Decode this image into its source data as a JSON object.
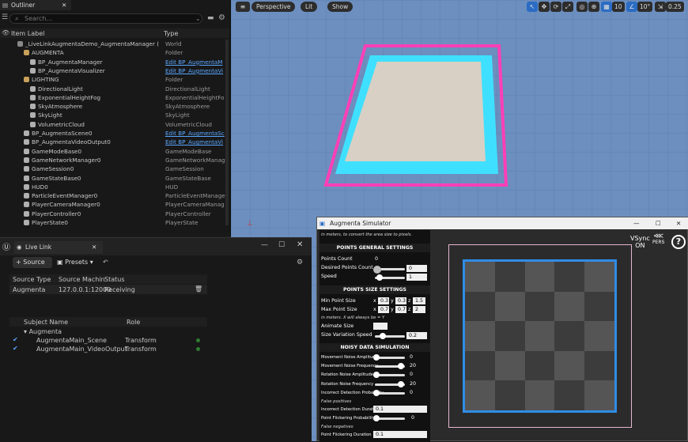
{
  "outliner": {
    "tab_label": "Outliner",
    "search_placeholder": "Search...",
    "col_label": "Item Label",
    "col_type": "Type",
    "rows": [
      {
        "name": "_LiveLinkAugmentaDemo_AugmentaManager (",
        "type": "World",
        "indent": 0,
        "link": false
      },
      {
        "name": "AUGMENTA",
        "type": "Folder",
        "indent": 1,
        "link": false
      },
      {
        "name": "BP_AugmentaManager",
        "type": "Edit BP_AugmentaM",
        "indent": 2,
        "link": true
      },
      {
        "name": "BP_AugmentaVisualizer",
        "type": "Edit BP_AugmentaVi",
        "indent": 2,
        "link": true
      },
      {
        "name": "LIGHTING",
        "type": "Folder",
        "indent": 1,
        "link": false
      },
      {
        "name": "DirectionalLight",
        "type": "DirectionalLight",
        "indent": 2,
        "link": false
      },
      {
        "name": "ExponentialHeightFog",
        "type": "ExponentialHeightFo",
        "indent": 2,
        "link": false
      },
      {
        "name": "SkyAtmosphere",
        "type": "SkyAtmosphere",
        "indent": 2,
        "link": false
      },
      {
        "name": "SkyLight",
        "type": "SkyLight",
        "indent": 2,
        "link": false
      },
      {
        "name": "VolumetricCloud",
        "type": "VolumetricCloud",
        "indent": 2,
        "link": false
      },
      {
        "name": "BP_AugmentaScene0",
        "type": "Edit BP_AugmentaSc",
        "indent": 1,
        "link": true
      },
      {
        "name": "BP_AugmentaVideoOutput0",
        "type": "Edit BP_AugmentaVi",
        "indent": 1,
        "link": true
      },
      {
        "name": "GameModeBase0",
        "type": "GameModeBase",
        "indent": 1,
        "link": false
      },
      {
        "name": "GameNetworkManager0",
        "type": "GameNetworkManag",
        "indent": 1,
        "link": false
      },
      {
        "name": "GameSession0",
        "type": "GameSession",
        "indent": 1,
        "link": false
      },
      {
        "name": "GameStateBase0",
        "type": "GameStateBase",
        "indent": 1,
        "link": false
      },
      {
        "name": "HUD0",
        "type": "HUD",
        "indent": 1,
        "link": false
      },
      {
        "name": "ParticleEventManager0",
        "type": "ParticleEventManage",
        "indent": 1,
        "link": false
      },
      {
        "name": "PlayerCameraManager0",
        "type": "PlayerCameraManag",
        "indent": 1,
        "link": false
      },
      {
        "name": "PlayerController0",
        "type": "PlayerController",
        "indent": 1,
        "link": false
      },
      {
        "name": "PlayerState0",
        "type": "PlayerState",
        "indent": 1,
        "link": false
      }
    ]
  },
  "viewport": {
    "perspective": "Perspective",
    "lit": "Lit",
    "show": "Show",
    "grid_snap": "10",
    "angle_snap": "10°",
    "camera_speed": "0.25",
    "colors": {
      "sky": "#6c8fbf",
      "pink": "#ff3fb6",
      "cyan": "#3fe0ff",
      "floor": "#d8d0c4"
    }
  },
  "livelink": {
    "tab_label": "Live Link",
    "source_button": "Source",
    "presets_button": "Presets",
    "col_source_type": "Source Type",
    "col_source_machine": "Source Machin",
    "col_status": "Status",
    "source_row": {
      "type": "Augmenta",
      "machine": "127.0.0.1:12000",
      "status": "Receiving"
    },
    "col_subject": "Subject Name",
    "col_role": "Role",
    "group": "Augmenta",
    "subjects": [
      {
        "name": "AugmentaMain_Scene",
        "role": "Transform"
      },
      {
        "name": "AugmentaMain_VideoOutput",
        "role": "Transform"
      }
    ]
  },
  "augmenta": {
    "window_title": "Augmenta Simulator",
    "top_note": "in meters, to convert the area size to pixels.",
    "general_header": "POINTS GENERAL SETTINGS",
    "points_count_label": "Points Count",
    "points_count_value": "0",
    "desired_label": "Desired Points Count",
    "desired_value": "0",
    "speed_label": "Speed",
    "speed_value": "1",
    "size_header": "POINTS SIZE SETTINGS",
    "min_label": "Min Point Size",
    "min_x": "0.3",
    "min_y": "0.3",
    "min_z": "1.5",
    "max_label": "Max Point Size",
    "max_x": "0.7",
    "max_y": "0.7",
    "max_z": "2",
    "size_note": "in meters. X will always be = Y",
    "animate_label": "Animate Size",
    "variation_label": "Size Variation Speed",
    "variation_value": "0.2",
    "noise_header": "NOISY DATA SIMULATION",
    "noise_rows": [
      {
        "label": "Movement Noise Amplitude",
        "value": "0",
        "fill": 0.0
      },
      {
        "label": "Movement Noise Frequency",
        "value": "20",
        "fill": 0.9
      },
      {
        "label": "Rotation Noise Amplitude",
        "value": "0",
        "fill": 0.0
      },
      {
        "label": "Rotation Noise Frequency",
        "value": "20",
        "fill": 0.9
      },
      {
        "label": "Incorrect Detection Probability",
        "value": "0",
        "fill": 0.0
      }
    ],
    "false_positives": "False positives",
    "incorrect_duration_label": "Incorrect Detection Duration",
    "incorrect_duration_value": "0.1",
    "flicker_prob_label": "Point Flickering Probability",
    "flicker_prob_value": "0",
    "false_negatives": "False negatives",
    "flicker_duration_label": "Point Flickering Duration",
    "flicker_duration_value": "0.1",
    "vsync_label": "VSync",
    "vsync_value": "ON",
    "pers_label": "PERS",
    "help_glyph": "?",
    "colors": {
      "outer_frame": "#e6b6cf",
      "area_border": "#2f8de6",
      "tile_dark": "#3c3c3c",
      "tile_light": "#555555"
    }
  }
}
